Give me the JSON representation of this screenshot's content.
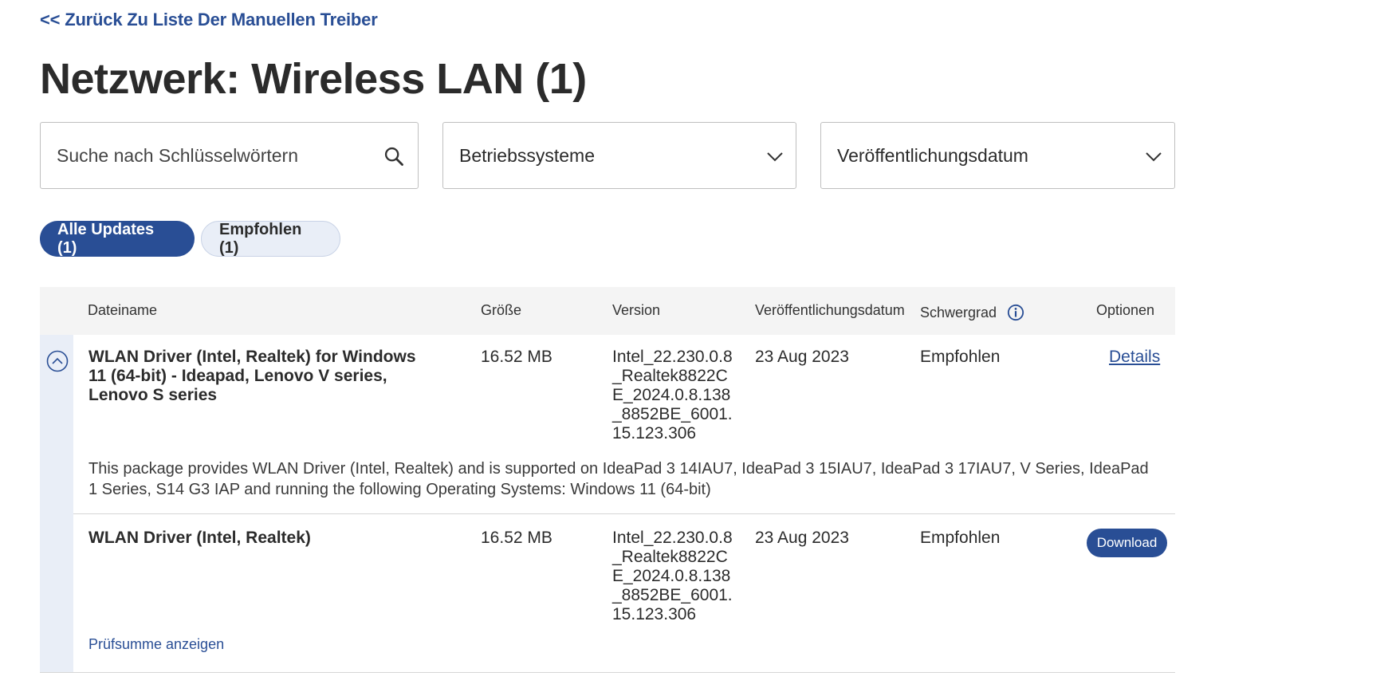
{
  "nav": {
    "back_label": "<< Zurück Zu Liste Der Manuellen Treiber"
  },
  "page": {
    "title": "Netzwerk: Wireless LAN (1)"
  },
  "filters": {
    "search_placeholder": "Suche nach Schlüsselwörtern",
    "os_label": "Betriebssysteme",
    "date_label": "Veröffentlichungsdatum"
  },
  "tabs": [
    {
      "label": "Alle Updates (1)",
      "active": true
    },
    {
      "label": "Empfohlen (1)",
      "active": false
    }
  ],
  "table": {
    "headers": {
      "name": "Dateiname",
      "size": "Größe",
      "version": "Version",
      "date": "Veröffentlichungsdatum",
      "severity": "Schwergrad",
      "options": "Optionen"
    },
    "package": {
      "name": "WLAN Driver (Intel, Realtek) for Windows 11 (64-bit) - Ideapad, Lenovo V series, Lenovo S series",
      "size": "16.52 MB",
      "version": "Intel_22.230.0.8_Realtek8822CE_2024.0.8.138_8852BE_6001.15.123.306",
      "date": "23 Aug 2023",
      "severity": "Empfohlen",
      "option_label": "Details",
      "description": "This package provides WLAN Driver (Intel, Realtek) and is supported on IdeaPad 3 14IAU7, IdeaPad 3 15IAU7, IdeaPad 3 17IAU7, V Series, IdeaPad 1 Series, S14 G3 IAP and running the following Operating Systems: Windows 11 (64-bit)"
    },
    "file": {
      "name": "WLAN Driver (Intel, Realtek)",
      "size": "16.52 MB",
      "version": "Intel_22.230.0.8_Realtek8822CE_2024.0.8.138_8852BE_6001.15.123.306",
      "date": "23 Aug 2023",
      "severity": "Empfohlen",
      "option_label": "Download",
      "checksum_label": "Prüfsumme anzeigen"
    }
  },
  "icons": {
    "search": "search-icon",
    "dropdown": "chevron-down-icon",
    "info": "info-icon",
    "collapse": "chevron-up-circle-icon"
  },
  "colors": {
    "accent": "#294e95",
    "pill_inactive": "#e9eef7",
    "header_bg": "#f4f4f4"
  }
}
